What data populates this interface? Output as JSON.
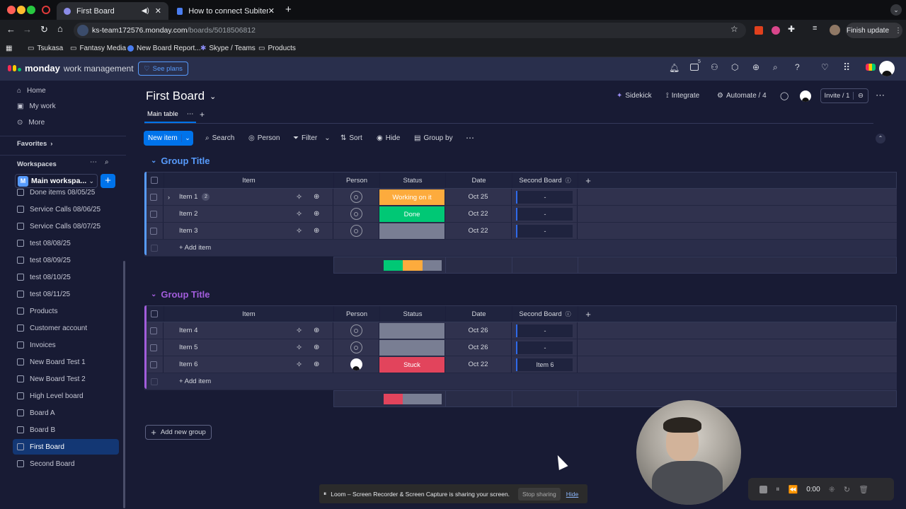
{
  "browser": {
    "tabs": [
      {
        "title": "First Board"
      },
      {
        "title": "How to connect Subitems of"
      }
    ],
    "url_domain": "ks-team172576.monday.com",
    "url_path": "/boards/5018506812",
    "finish_update": "Finish update",
    "bookmarks": [
      "Tsukasa",
      "Fantasy Media",
      "New Board Report...",
      "Skype / Teams",
      "Products"
    ]
  },
  "header": {
    "logo_bold": "monday",
    "logo_light": "work management",
    "see_plans": "See plans",
    "inbox_badge": "5"
  },
  "sidebar": {
    "nav": [
      {
        "label": "Home",
        "icon": "home-icon"
      },
      {
        "label": "My work",
        "icon": "calendar-icon"
      },
      {
        "label": "More",
        "icon": "more-icon"
      }
    ],
    "favorites": "Favorites",
    "workspaces": "Workspaces",
    "workspace_name": "Main workspa...",
    "workspace_initial": "M",
    "boards": [
      "Done items 08/05/25",
      "Service Calls 08/06/25",
      "Service Calls 08/07/25",
      "test 08/08/25",
      "test 08/09/25",
      "test 08/10/25",
      "test 08/11/25",
      "Products",
      "Customer account",
      "Invoices",
      "New Board Test 1",
      "New Board Test 2",
      "High Level board",
      "Board A",
      "Board B",
      "First Board",
      "Second Board"
    ],
    "active_board": "First Board"
  },
  "board": {
    "title": "First Board",
    "sidekick": "Sidekick",
    "integrate": "Integrate",
    "automate": "Automate / 4",
    "invite": "Invite / 1",
    "view_tab": "Main table",
    "toolbar": {
      "new_item": "New item",
      "search": "Search",
      "person": "Person",
      "filter": "Filter",
      "sort": "Sort",
      "hide": "Hide",
      "group_by": "Group by"
    },
    "columns": {
      "item": "Item",
      "person": "Person",
      "status": "Status",
      "date": "Date",
      "second_board": "Second Board"
    },
    "add_item": "+ Add item",
    "add_group": "Add new group",
    "groups": [
      {
        "title": "Group Title",
        "color": "#579bfc",
        "rows": [
          {
            "name": "Item 1",
            "subitems": "2",
            "status": "Working on it",
            "status_color": "#fdab3d",
            "date": "Oct 25",
            "second_board": "-",
            "has_avatar": false
          },
          {
            "name": "Item 2",
            "subitems": "",
            "status": "Done",
            "status_color": "#00c875",
            "date": "Oct 22",
            "second_board": "-",
            "has_avatar": false
          },
          {
            "name": "Item 3",
            "subitems": "",
            "status": "",
            "status_color": "#797e93",
            "date": "Oct 22",
            "second_board": "-",
            "has_avatar": false
          }
        ],
        "summary": [
          {
            "color": "#00c875",
            "share": 0.333
          },
          {
            "color": "#fdab3d",
            "share": 0.333
          },
          {
            "color": "#797e93",
            "share": 0.334
          }
        ]
      },
      {
        "title": "Group Title",
        "color": "#a25ddc",
        "rows": [
          {
            "name": "Item 4",
            "subitems": "",
            "status": "",
            "status_color": "#797e93",
            "date": "Oct 26",
            "second_board": "-",
            "has_avatar": false
          },
          {
            "name": "Item 5",
            "subitems": "",
            "status": "",
            "status_color": "#797e93",
            "date": "Oct 26",
            "second_board": "-",
            "has_avatar": false
          },
          {
            "name": "Item 6",
            "subitems": "",
            "status": "Stuck",
            "status_color": "#e2445c",
            "date": "Oct 22",
            "second_board": "Item 6",
            "has_avatar": true
          }
        ],
        "summary": [
          {
            "color": "#e2445c",
            "share": 0.333
          },
          {
            "color": "#797e93",
            "share": 0.667
          }
        ]
      }
    ]
  },
  "loom": {
    "share_text": "Loom – Screen Recorder & Screen Capture is sharing your screen.",
    "stop": "Stop sharing",
    "hide": "Hide",
    "timer": "0:00"
  }
}
